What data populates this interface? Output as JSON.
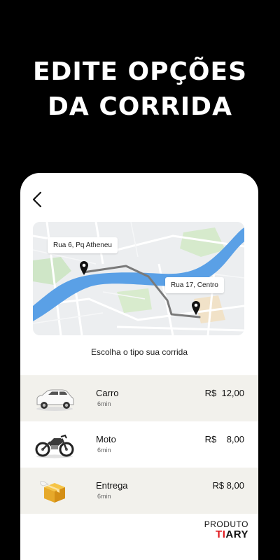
{
  "headline": {
    "line1": "EDITE OPÇÕES",
    "line2": "DA CORRIDA"
  },
  "map": {
    "origin_label": "Rua 6, Pq Atheneu",
    "destination_label": "Rua 17, Centro",
    "river_color": "#5aa0e6",
    "route_color": "#7a7a7a"
  },
  "prompt": "Escolha o tipo sua corrida",
  "rides": [
    {
      "name": "Carro",
      "time": "6min",
      "price": "R$  12,00",
      "icon": "car-icon"
    },
    {
      "name": "Moto",
      "time": "6min",
      "price": "R$    8,00",
      "icon": "motorcycle-icon"
    },
    {
      "name": "Entrega",
      "time": "6min",
      "price": "R$ 8,00",
      "icon": "package-icon"
    }
  ],
  "brand": {
    "top": "PRODUTO",
    "logo_red": "TI",
    "logo_dark": "ARY"
  }
}
